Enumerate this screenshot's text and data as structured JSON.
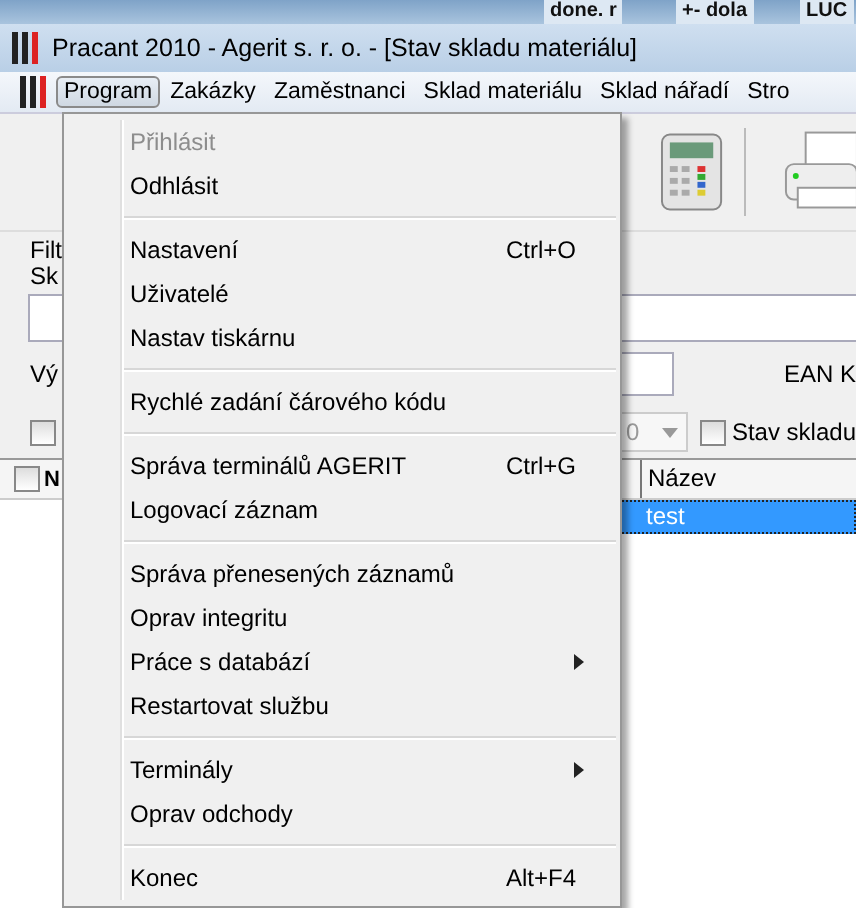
{
  "taskbar_items": [
    "done. r",
    "+- dola",
    "LUC"
  ],
  "window": {
    "title": "Pracant 2010 - Agerit s. r. o. - [Stav skladu materiálu]"
  },
  "menu_bar": [
    {
      "label": "Program",
      "selected": true
    },
    {
      "label": "Zakázky",
      "selected": false
    },
    {
      "label": "Zaměstnanci",
      "selected": false
    },
    {
      "label": "Sklad materiálu",
      "selected": false
    },
    {
      "label": "Sklad nářadí",
      "selected": false
    },
    {
      "label": "Stro",
      "selected": false
    }
  ],
  "form": {
    "label_1": "Filt",
    "label_2": "Sk",
    "label_3": "Vý",
    "ean_label": "EAN K",
    "left_checkbox": {
      "checked": false
    },
    "dropdown_value": "0",
    "stock_checkbox": {
      "label": "Stav skladu",
      "checked": false
    }
  },
  "table": {
    "header_checkbox": {
      "checked": false
    },
    "columns": [
      "N",
      "Název"
    ],
    "rows": [
      {
        "cells": [
          "",
          "test"
        ],
        "selected": true
      }
    ]
  },
  "menu": {
    "items": [
      {
        "kind": "item",
        "label": "Přihlásit",
        "disabled": true
      },
      {
        "kind": "item",
        "label": "Odhlásit",
        "disabled": false
      },
      {
        "kind": "separator"
      },
      {
        "kind": "item",
        "label": "Nastavení",
        "shortcut": "Ctrl+O",
        "disabled": false
      },
      {
        "kind": "item",
        "label": "Uživatelé",
        "disabled": false
      },
      {
        "kind": "item",
        "label": "Nastav tiskárnu",
        "disabled": false
      },
      {
        "kind": "separator"
      },
      {
        "kind": "item",
        "label": "Rychlé zadání čárového kódu",
        "disabled": false
      },
      {
        "kind": "separator"
      },
      {
        "kind": "item",
        "label": "Správa terminálů AGERIT",
        "shortcut": "Ctrl+G",
        "disabled": false
      },
      {
        "kind": "item",
        "label": "Logovací záznam",
        "disabled": false
      },
      {
        "kind": "separator"
      },
      {
        "kind": "item",
        "label": "Správa přenesených záznamů",
        "disabled": false
      },
      {
        "kind": "item",
        "label": "Oprav integritu",
        "disabled": false
      },
      {
        "kind": "item",
        "label": "Práce s databází",
        "submenu": true,
        "disabled": false
      },
      {
        "kind": "item",
        "label": "Restartovat službu",
        "disabled": false
      },
      {
        "kind": "separator"
      },
      {
        "kind": "item",
        "label": "Terminály",
        "submenu": true,
        "disabled": false
      },
      {
        "kind": "item",
        "label": "Oprav odchody",
        "disabled": false
      },
      {
        "kind": "separator"
      },
      {
        "kind": "item",
        "label": "Konec",
        "shortcut": "Alt+F4",
        "disabled": false
      }
    ]
  }
}
